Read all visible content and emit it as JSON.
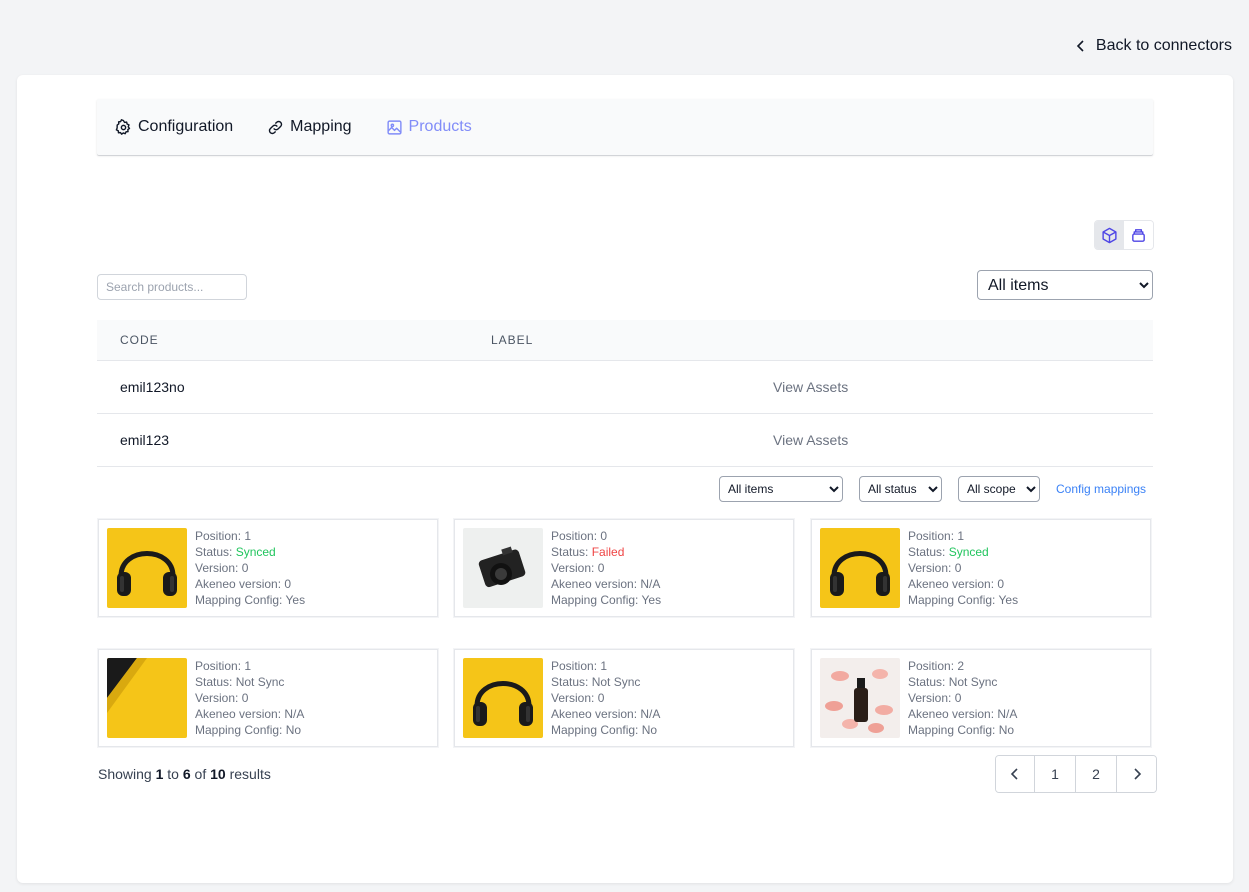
{
  "header": {
    "back_label": "Back to connectors"
  },
  "tabs": [
    {
      "label": "Configuration",
      "icon": "gear-icon",
      "active": false
    },
    {
      "label": "Mapping",
      "icon": "link-icon",
      "active": false
    },
    {
      "label": "Products",
      "icon": "image-icon",
      "active": true
    }
  ],
  "toolbar": {
    "search_placeholder": "Search products...",
    "filter_selected": "All items"
  },
  "table": {
    "columns": [
      "CODE",
      "LABEL"
    ],
    "rows": [
      {
        "code": "emil123no",
        "label": "",
        "action": "View Assets"
      },
      {
        "code": "emil123",
        "label": "",
        "action": "View Assets"
      }
    ]
  },
  "asset_filters": {
    "items": "All items",
    "status": "All status",
    "scope": "All scope",
    "config_link": "Config mappings"
  },
  "assets": [
    {
      "position": "1",
      "status": "Synced",
      "version": "0",
      "akeneo_version": "0",
      "mapping_config": "Yes",
      "image": "headphones"
    },
    {
      "position": "0",
      "status": "Failed",
      "version": "0",
      "akeneo_version": "N/A",
      "mapping_config": "Yes",
      "image": "camera"
    },
    {
      "position": "1",
      "status": "Synced",
      "version": "0",
      "akeneo_version": "0",
      "mapping_config": "Yes",
      "image": "headphones"
    },
    {
      "position": "1",
      "status": "Not Sync",
      "version": "0",
      "akeneo_version": "N/A",
      "mapping_config": "No",
      "image": "yellow-object"
    },
    {
      "position": "1",
      "status": "Not Sync",
      "version": "0",
      "akeneo_version": "N/A",
      "mapping_config": "No",
      "image": "headphones"
    },
    {
      "position": "2",
      "status": "Not Sync",
      "version": "0",
      "akeneo_version": "N/A",
      "mapping_config": "No",
      "image": "bottle-petals"
    }
  ],
  "labels": {
    "position": "Position: ",
    "status": "Status: ",
    "version": "Version: ",
    "akeneo_version": "Akeneo version: ",
    "mapping_config": "Mapping Config: "
  },
  "pagination": {
    "showing": "Showing",
    "from": "1",
    "to_word": "to",
    "to": "6",
    "of_word": "of",
    "total": "10",
    "results_word": "results",
    "pages": [
      "1",
      "2"
    ]
  },
  "colors": {
    "accent": "#818cf8",
    "success": "#22c55e",
    "error": "#ef4444",
    "link": "#3b82f6"
  }
}
